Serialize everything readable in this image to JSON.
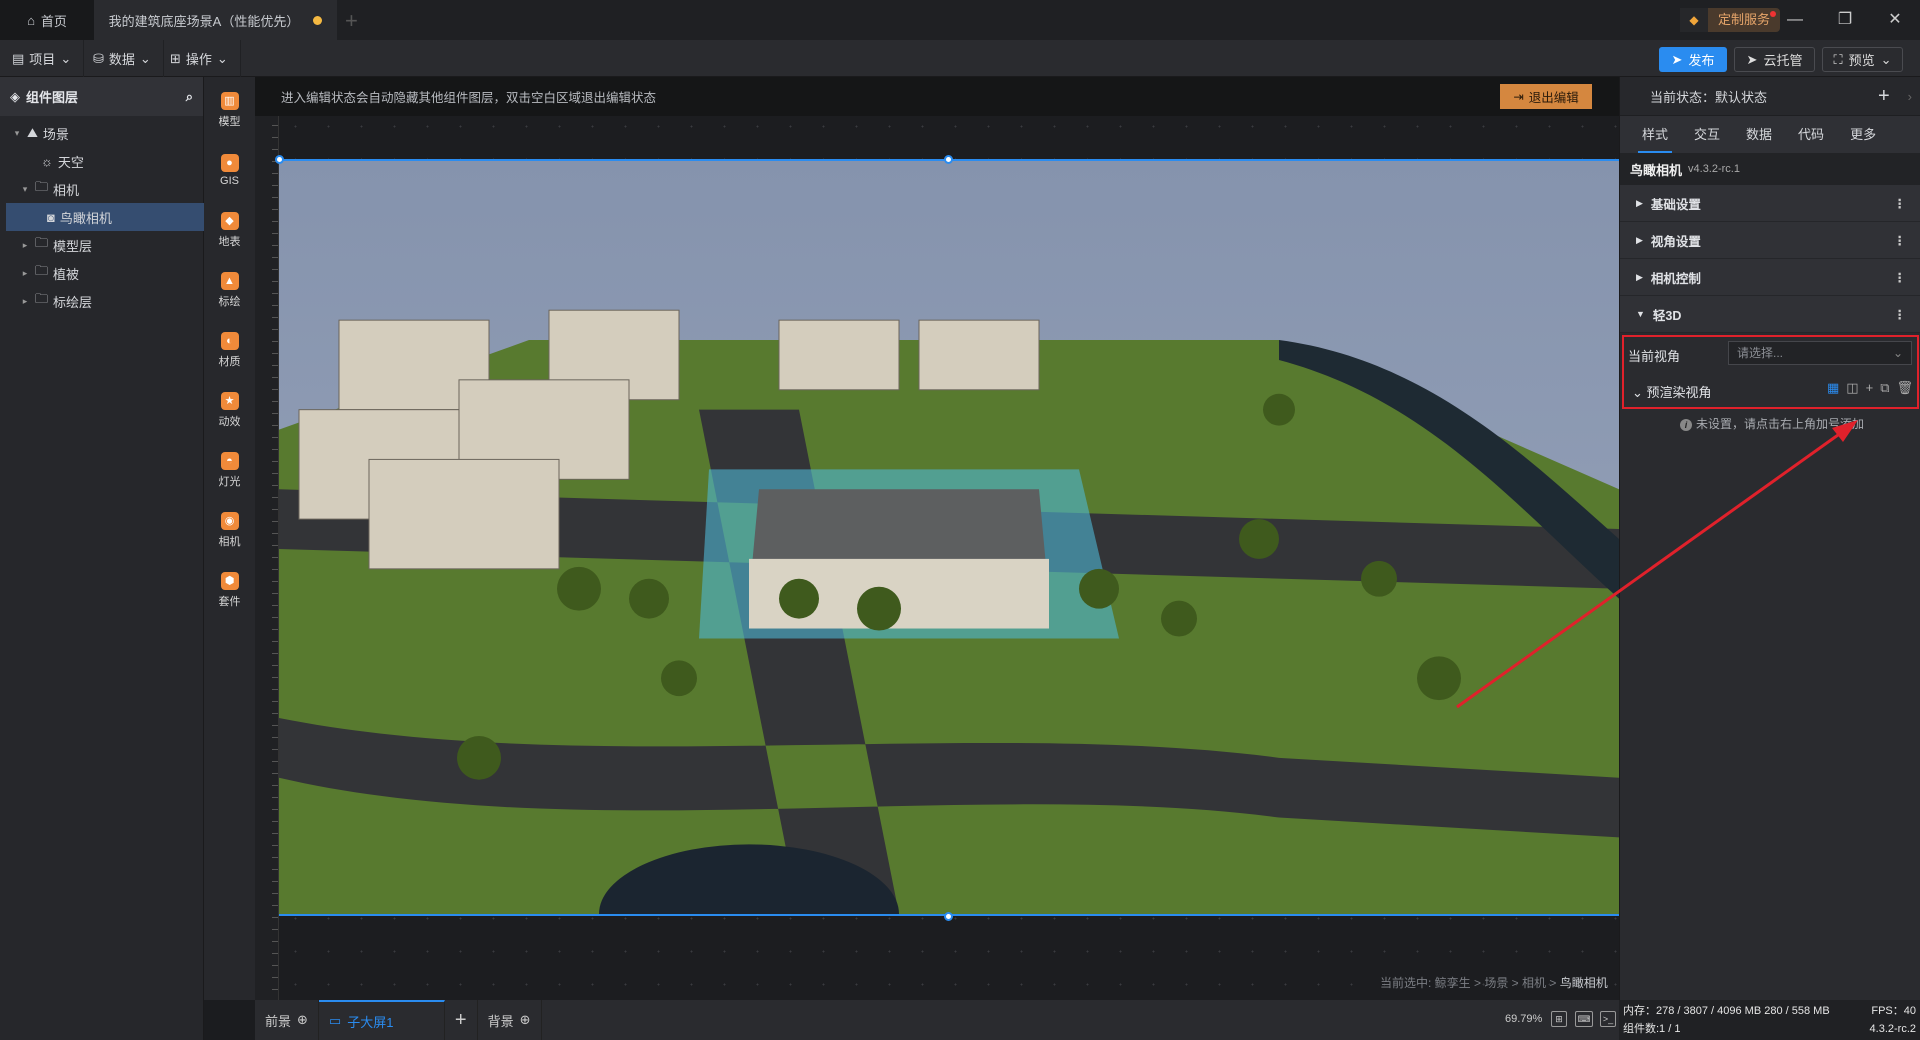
{
  "titlebar": {
    "home_tab": "首页",
    "scene_tab": "我的建筑底座场景A（性能优先）",
    "custom_service": "定制服务"
  },
  "toolbar": {
    "menus": [
      "项目",
      "数据",
      "操作"
    ],
    "publish": "发布",
    "cloud": "云托管",
    "preview": "预览"
  },
  "left_panel": {
    "title": "组件图层",
    "tree": [
      {
        "label": "场景",
        "icon": "scene-icon",
        "caret": "▾"
      },
      {
        "label": "天空",
        "icon": "sky-icon",
        "caret": ""
      },
      {
        "label": "相机",
        "icon": "folder-icon",
        "caret": "▾"
      },
      {
        "label": "鸟瞰相机",
        "icon": "camera-icon",
        "caret": "",
        "selected": true
      },
      {
        "label": "模型层",
        "icon": "folder-icon",
        "caret": "▸"
      },
      {
        "label": "植被",
        "icon": "folder-icon",
        "caret": "▸"
      },
      {
        "label": "标绘层",
        "icon": "folder-icon",
        "caret": "▸"
      }
    ]
  },
  "tools": [
    "模型",
    "GIS",
    "地表",
    "标绘",
    "材质",
    "动效",
    "灯光",
    "相机",
    "套件"
  ],
  "canvas": {
    "notice": "进入编辑状态会自动隐藏其他组件图层，双击空白区域退出编辑状态",
    "exit_edit": "退出编辑",
    "breadcrumb_prefix": "当前选中: 鲸孪生 > 场景 > 相机 > ",
    "breadcrumb_current": "鸟瞰相机"
  },
  "bottom": {
    "tabs": [
      "前景",
      "子大屏1",
      "背景"
    ],
    "zoom": "69.79%"
  },
  "stats": {
    "memory": "内存：278 / 3807 / 4096 MB  280 / 558 MB",
    "fps": "FPS：40",
    "components": "组件数:1 / 1",
    "version": "4.3.2-rc.2"
  },
  "right_panel": {
    "state": "当前状态：默认状态",
    "tabs": [
      "样式",
      "交互",
      "数据",
      "代码",
      "更多"
    ],
    "component": "鸟瞰相机",
    "component_version": "v4.3.2-rc.1",
    "sections": [
      "基础设置",
      "视角设置",
      "相机控制",
      "轻3D"
    ],
    "current_view_label": "当前视角",
    "current_view_placeholder": "请选择...",
    "prerender_label": "预渲染视角",
    "info": "未设置，请点击右上角加号添加"
  },
  "colors": {
    "accent": "#2a8cf0",
    "highlight": "#e0212b",
    "exit": "#d5873f"
  }
}
